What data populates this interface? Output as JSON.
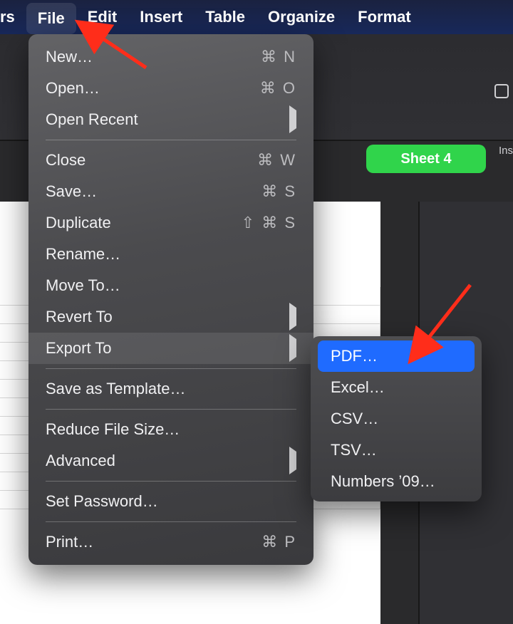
{
  "menubar": {
    "items": [
      {
        "label": "rs",
        "partial": true
      },
      {
        "label": "File",
        "active": true
      },
      {
        "label": "Edit"
      },
      {
        "label": "Insert"
      },
      {
        "label": "Table"
      },
      {
        "label": "Organize"
      },
      {
        "label": "Format"
      }
    ]
  },
  "toolbar": {
    "insert_label": "Ins"
  },
  "sheet": {
    "badge_label": "Sheet 4"
  },
  "file_menu": {
    "items": [
      {
        "label": "New…",
        "shortcut": "⌘ N"
      },
      {
        "label": "Open…",
        "shortcut": "⌘ O"
      },
      {
        "label": "Open Recent",
        "submenu": true
      },
      {
        "sep": true
      },
      {
        "label": "Close",
        "shortcut": "⌘ W"
      },
      {
        "label": "Save…",
        "shortcut": "⌘ S"
      },
      {
        "label": "Duplicate",
        "shortcut": "⇧ ⌘ S"
      },
      {
        "label": "Rename…"
      },
      {
        "label": "Move To…"
      },
      {
        "label": "Revert To",
        "submenu": true
      },
      {
        "label": "Export To",
        "submenu": true,
        "highlight": true
      },
      {
        "sep": true
      },
      {
        "label": "Save as Template…"
      },
      {
        "sep": true
      },
      {
        "label": "Reduce File Size…"
      },
      {
        "label": "Advanced",
        "submenu": true
      },
      {
        "sep": true
      },
      {
        "label": "Set Password…"
      },
      {
        "sep": true
      },
      {
        "label": "Print…",
        "shortcut": "⌘ P"
      }
    ]
  },
  "export_submenu": {
    "items": [
      {
        "label": "PDF…",
        "highlight": true
      },
      {
        "label": "Excel…"
      },
      {
        "label": "CSV…"
      },
      {
        "label": "TSV…"
      },
      {
        "label": "Numbers ’09…"
      }
    ]
  }
}
